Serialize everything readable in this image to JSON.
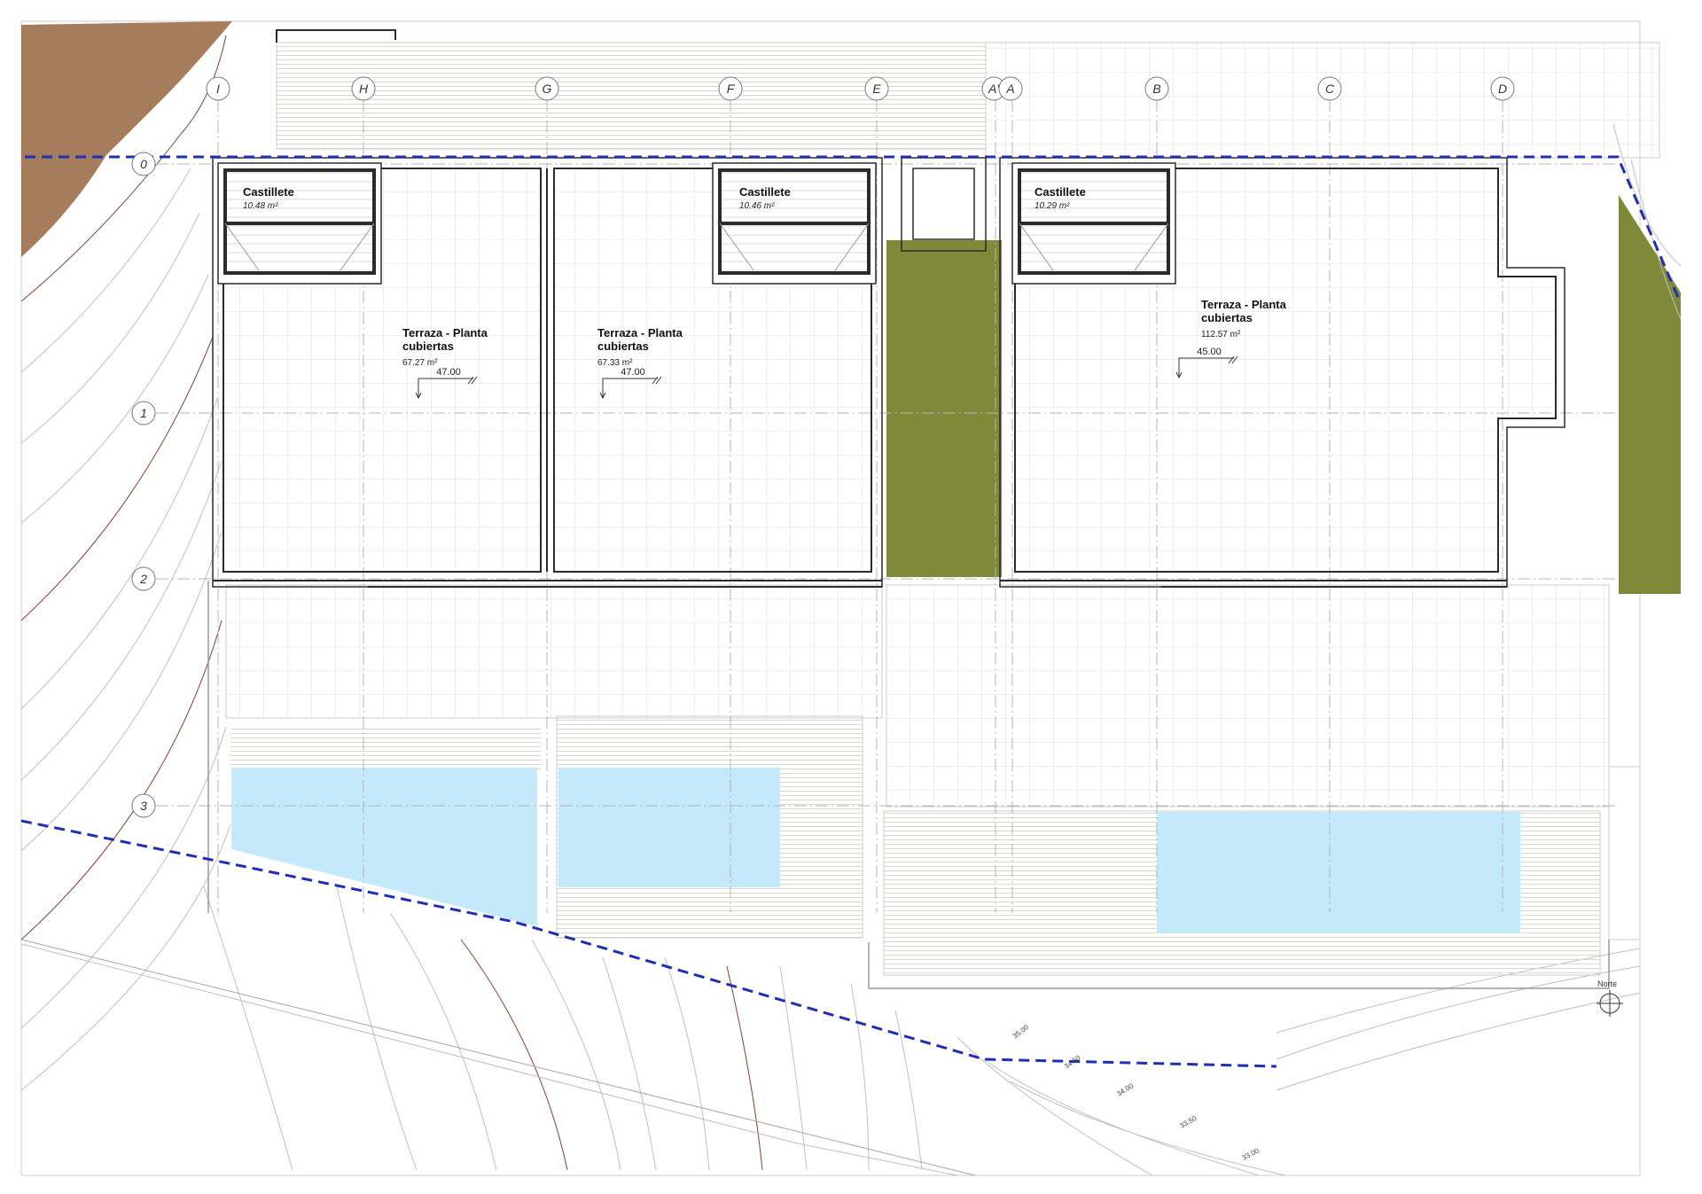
{
  "colors": {
    "terrain": "#a57d5c",
    "garden": "#7e8a3a",
    "pool": "#c3e9fb",
    "boundary": "#1f2fb5",
    "wall": "#2b2b2b",
    "paving_grid": "#d9d9d9",
    "axis": "#b5b5b5",
    "contour_gray": "#bfbfbf",
    "contour_red": "#8a3b33",
    "deck_hatch": "#d6d6c9"
  },
  "grid_axes": {
    "columns": [
      "I",
      "H",
      "G",
      "F",
      "E",
      "A'",
      "A",
      "B",
      "C",
      "D"
    ],
    "rows": [
      "0",
      "1",
      "2",
      "3"
    ]
  },
  "units": [
    {
      "castillete": {
        "name": "Castillete",
        "area": "10.48 m²"
      },
      "terrace": {
        "name_line1": "Terraza - Planta",
        "name_line2": "cubiertas",
        "area": "67.27 m²"
      },
      "level": "47.00"
    },
    {
      "castillete": {
        "name": "Castillete",
        "area": "10.46 m²"
      },
      "terrace": {
        "name_line1": "Terraza - Planta",
        "name_line2": "cubiertas",
        "area": "67.33 m²"
      },
      "level": "47.00"
    },
    {
      "castillete": {
        "name": "Castillete",
        "area": "10.29 m²"
      },
      "terrace": {
        "name_line1": "Terraza - Planta",
        "name_line2": "cubiertas",
        "area": "112.57 m²"
      },
      "level": "45.00"
    }
  ],
  "contour_labels": [
    "35.00",
    "34.50",
    "34.00",
    "33.50",
    "33.00"
  ],
  "north_label": "Norte"
}
